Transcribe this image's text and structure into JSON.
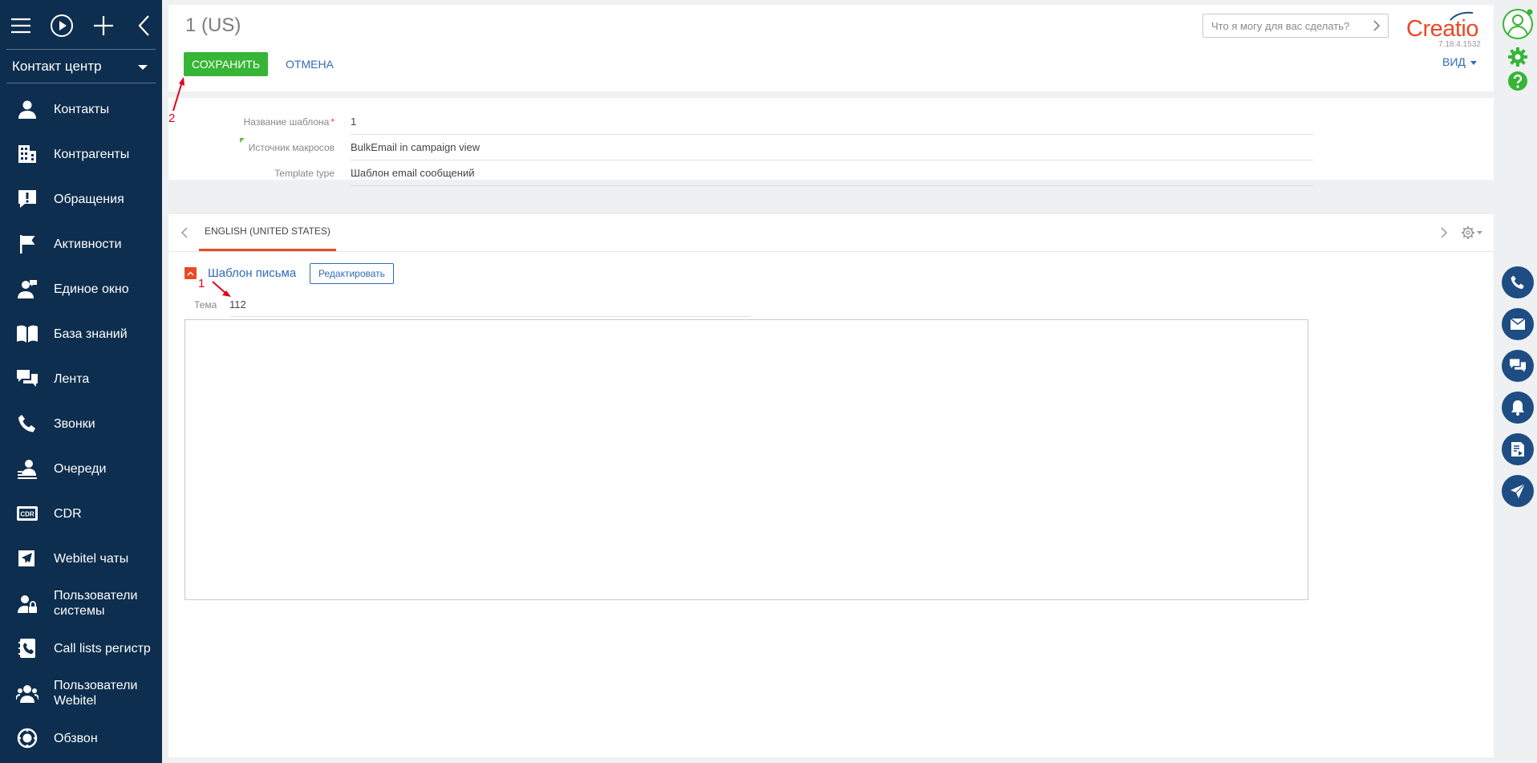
{
  "sidebar": {
    "workspace": "Контакт центр",
    "items": [
      {
        "label": "Контакты",
        "icon": "person-icon"
      },
      {
        "label": "Контрагенты",
        "icon": "building-icon"
      },
      {
        "label": "Обращения",
        "icon": "exclamation-icon"
      },
      {
        "label": "Активности",
        "icon": "flag-icon"
      },
      {
        "label": "Единое окно",
        "icon": "person-message-icon"
      },
      {
        "label": "База знаний",
        "icon": "book-icon"
      },
      {
        "label": "Лента",
        "icon": "chat-icon"
      },
      {
        "label": "Звонки",
        "icon": "phone-icon"
      },
      {
        "label": "Очереди",
        "icon": "queue-person-icon"
      },
      {
        "label": "CDR",
        "icon": "cdr-icon"
      },
      {
        "label": "Webitel чаты",
        "icon": "paper-plane-icon"
      },
      {
        "label": "Пользователи системы",
        "icon": "user-lock-icon"
      },
      {
        "label": "Call lists регистр",
        "icon": "phonebook-icon"
      },
      {
        "label": "Пользователи Webitel",
        "icon": "users-icon"
      },
      {
        "label": "Обзвон",
        "icon": "dialer-icon"
      }
    ]
  },
  "header": {
    "title": "1 (US)",
    "save_label": "СОХРАНИТЬ",
    "cancel_label": "ОТМЕНА",
    "search_placeholder": "Что я могу для вас сделать?",
    "logo_text": "Creatio",
    "version": "7.18.4.1532",
    "view_label": "ВИД"
  },
  "fields": [
    {
      "label": "Название шаблона",
      "value": "1",
      "required": true
    },
    {
      "label": "Источник макросов",
      "value": "BulkEmail in campaign view",
      "required": false
    },
    {
      "label": "Template type",
      "value": "Шаблон email сообщений",
      "required": false
    }
  ],
  "template": {
    "tab_label": "ENGLISH (UNITED STATES)",
    "group_title": "Шаблон письма",
    "edit_label": "Редактировать",
    "subject_label": "Тема",
    "subject_value": "112"
  },
  "annotations": {
    "one": "1",
    "two": "2"
  },
  "colors": {
    "sidebar": "#0d2e4e",
    "accent": "#e84a24",
    "save": "#36b537",
    "link": "#2f6cb7",
    "rail_button": "#1d4d83",
    "annotation": "#e3001b"
  }
}
